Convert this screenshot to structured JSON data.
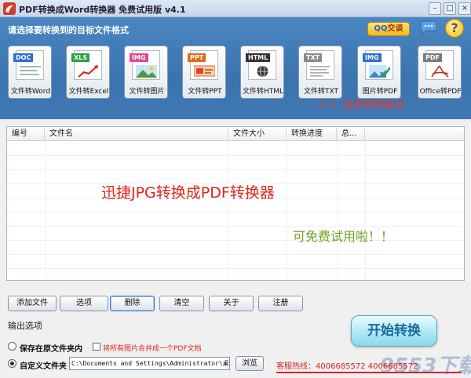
{
  "window": {
    "title": "PDF转换成Word转换器 免费试用版 v4.1",
    "minimize_icon": "minimize-icon",
    "maximize_icon": "maximize-icon",
    "close_icon": "close-icon"
  },
  "header": {
    "instruction": "请选择要转换到的目标文件格式",
    "qq_label": "QQ交谈",
    "qq_letters": "QQ",
    "qq_rest": "交谈",
    "help_glyph": "?"
  },
  "formats": [
    {
      "tag": "DOC",
      "label": "文件转Word",
      "tag_color": "#2f6fd0",
      "icon": "word-doc-icon"
    },
    {
      "tag": "XLS",
      "label": "文件转Excel",
      "tag_color": "#2ea043",
      "icon": "excel-chart-icon"
    },
    {
      "tag": "IMG",
      "label": "文件转图片",
      "tag_color": "#e04a90",
      "icon": "image-file-icon"
    },
    {
      "tag": "PPT",
      "label": "文件转PPT",
      "tag_color": "#e06a1a",
      "icon": "ppt-slides-icon"
    },
    {
      "tag": "HTML",
      "label": "文件转HTML",
      "tag_color": "#333333",
      "icon": "html-globe-icon"
    },
    {
      "tag": "TXT",
      "label": "文件转TXT",
      "tag_color": "#8a8a8a",
      "icon": "text-file-icon"
    },
    {
      "tag": "IMG",
      "label": "图片转PDF",
      "tag_color": "#2f6fd0",
      "icon": "image-to-pdf-icon"
    },
    {
      "tag": "PDF",
      "label": "Office转PDF",
      "tag_color": "#7a7a7a",
      "icon": "office-to-pdf-icon"
    }
  ],
  "mode_hint": "（一）选择转换模式",
  "table": {
    "columns": [
      "编号",
      "文件名",
      "文件大小",
      "转换进度",
      "总..."
    ],
    "rows": []
  },
  "overlay": {
    "title": "迅捷JPG转换成PDF转换器",
    "free": "可免费试用啦！！"
  },
  "actions": {
    "add": "添加文件",
    "select": "选项",
    "delete": "删除",
    "clear": "清空",
    "about": "关于",
    "register": "注册"
  },
  "output": {
    "section_label": "输出选项",
    "keep_original": "保存在原文件夹内",
    "merge_images": "将所有图片合并成一个PDF文档",
    "custom_folder": "自定义文件夹",
    "path_value": "C:\\Documents and Settings\\Administrator\\桌面",
    "browse": "浏览",
    "selected": "custom"
  },
  "start_label": "开始转换",
  "hotline": "客服热线：4006685572  4006685572",
  "watermark": "9553下载"
}
